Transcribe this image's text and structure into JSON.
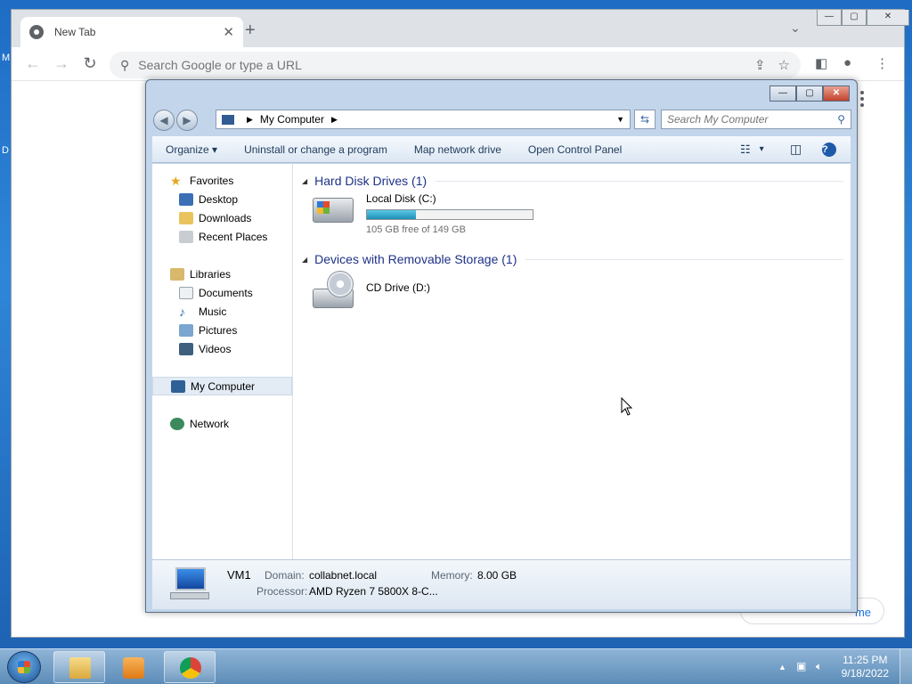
{
  "desktop": {
    "edge_letters": [
      "M",
      "D"
    ]
  },
  "chrome": {
    "tab_title": "New Tab",
    "tab_close": "✕",
    "new_tab": "+",
    "tab_menu": "⌄",
    "win_min": "—",
    "win_max": "▢",
    "win_close": "✕",
    "omnibox_placeholder": "Search Google or type a URL",
    "bottom_pill_text": "me"
  },
  "explorer": {
    "breadcrumb": "My Computer",
    "search_placeholder": "Search My Computer",
    "commands": [
      "Organize ▾",
      "Uninstall or change a program",
      "Map network drive",
      "Open Control Panel"
    ],
    "view_label": "▾",
    "help_label": "?",
    "nav": {
      "favorites": "Favorites",
      "favorites_items": [
        "Desktop",
        "Downloads",
        "Recent Places"
      ],
      "libraries": "Libraries",
      "libraries_items": [
        "Documents",
        "Music",
        "Pictures",
        "Videos"
      ],
      "computer": "My Computer",
      "network": "Network"
    },
    "groups": [
      {
        "title": "Hard Disk Drives (1)"
      },
      {
        "title": "Devices with Removable Storage (1)"
      }
    ],
    "drives": [
      {
        "name": "Local Disk (C:)",
        "free_text": "105 GB free of 149 GB",
        "used_fraction": 0.295
      },
      {
        "name": "CD Drive (D:)"
      }
    ],
    "details": {
      "name": "VM1",
      "domain_label": "Domain:",
      "domain_value": "collabnet.local",
      "memory_label": "Memory:",
      "memory_value": "8.00 GB",
      "processor_label": "Processor:",
      "processor_value": "AMD Ryzen 7 5800X 8-C..."
    }
  },
  "taskbar": {
    "time": "11:25 PM",
    "date": "9/18/2022"
  },
  "colors": {
    "accent_blue": "#1e3287",
    "progress": "#1f8fb8"
  }
}
